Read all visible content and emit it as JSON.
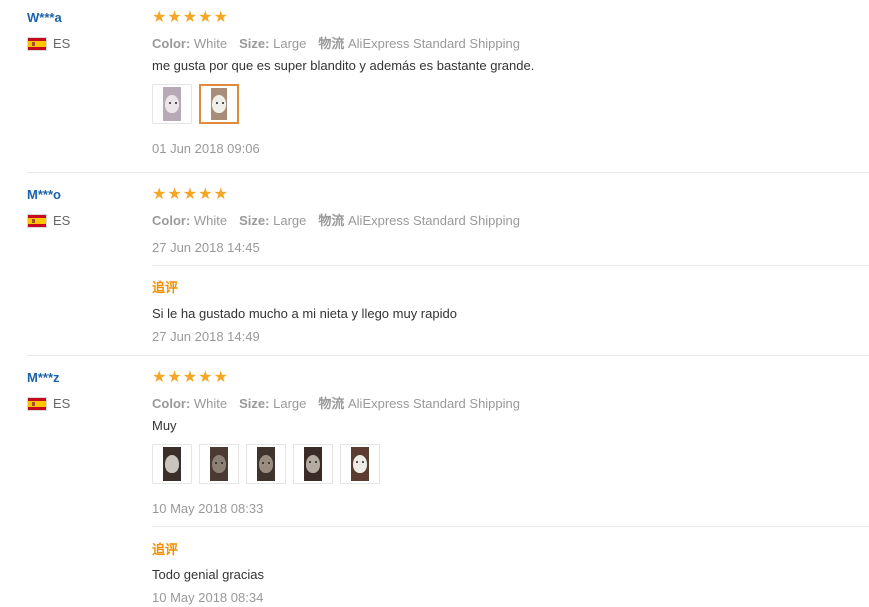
{
  "reviews": [
    {
      "user": "W***a",
      "country": "ES",
      "meta": {
        "color_label": "Color:",
        "color_value": "White",
        "size_label": "Size:",
        "size_value": "Large",
        "shipping_label": "物流",
        "shipping_value": "AliExpress Standard Shipping"
      },
      "text": "me gusta por que es super blandito y además es bastante grande.",
      "date": "01 Jun 2018 09:06"
    },
    {
      "user": "M***o",
      "country": "ES",
      "meta": {
        "color_label": "Color:",
        "color_value": "White",
        "size_label": "Size:",
        "size_value": "Large",
        "shipping_label": "物流",
        "shipping_value": "AliExpress Standard Shipping"
      },
      "date": "27 Jun 2018 14:45",
      "additional": {
        "label": "追评",
        "text": "Si le ha gustado mucho a mi nieta y llego muy rapido",
        "date": "27 Jun 2018 14:49"
      }
    },
    {
      "user": "M***z",
      "country": "ES",
      "meta": {
        "color_label": "Color:",
        "color_value": "White",
        "size_label": "Size:",
        "size_value": "Large",
        "shipping_label": "物流",
        "shipping_value": "AliExpress Standard Shipping"
      },
      "text": "Muy",
      "date": "10 May 2018 08:33",
      "additional": {
        "label": "追评",
        "text": "Todo genial gracias",
        "date": "10 May 2018 08:34"
      }
    }
  ],
  "rating": 5,
  "star_color": "#f5a623",
  "user_color": "#1a63a8",
  "followup_color": "#f08f00"
}
